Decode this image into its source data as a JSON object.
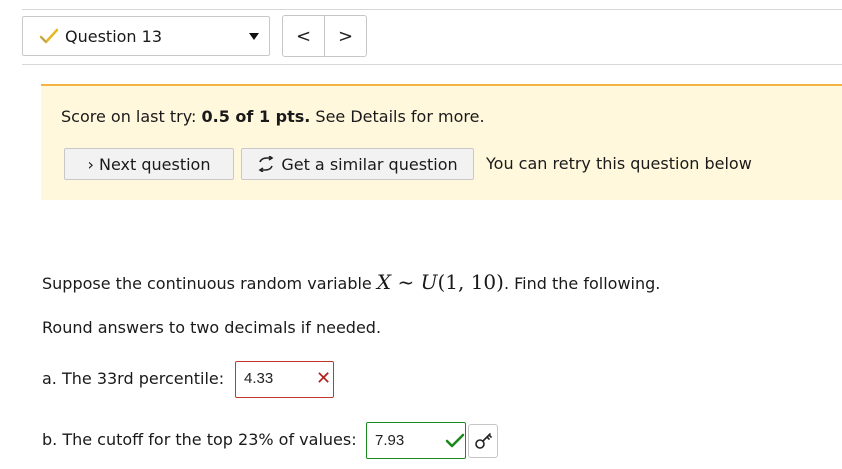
{
  "question_nav": {
    "selected_question": "Question 13",
    "prev_label": "<",
    "next_label": ">"
  },
  "banner": {
    "score_prefix": "Score on last try: ",
    "score_value": "0.5 of 1 pts.",
    "score_suffix": " See Details for more.",
    "next_button": "› Next question",
    "similar_button": "Get a similar question",
    "retry_text": "You can retry this question below"
  },
  "question": {
    "prompt_before": "Suppose the continuous random variable ",
    "math_var": "X",
    "math_sim": " ~ ",
    "math_dist": "U",
    "math_args": "(1, 10)",
    "prompt_after": ". Find the following.",
    "round_instruction": "Round answers to two decimals if needed.",
    "part_a_label": "a. The 33rd percentile:",
    "part_a_value": "4.33",
    "part_b_label": "b. The cutoff for the top 23% of values:",
    "part_b_value": "7.93"
  },
  "colors": {
    "banner_bg": "#fff8dc",
    "banner_accent": "#f5b342",
    "incorrect": "#b21f1f",
    "correct": "#1e8a1e",
    "check_yellow": "#e6b820"
  },
  "icons": {
    "question_status": "partial-check-icon",
    "similar": "refresh-icon",
    "part_a_status": "x-icon",
    "part_b_status": "check-icon",
    "key": "key-icon"
  }
}
